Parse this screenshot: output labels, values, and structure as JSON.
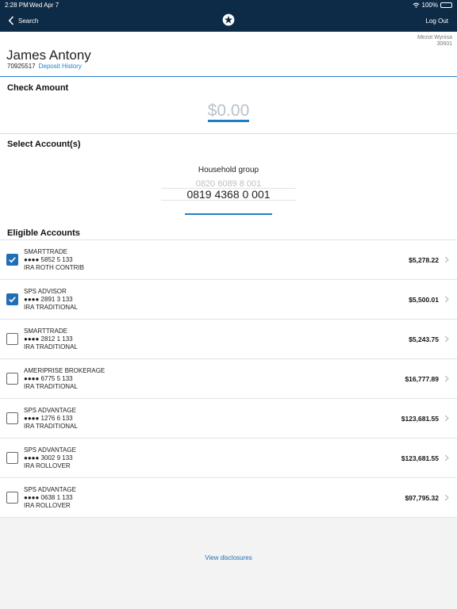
{
  "status": {
    "time": "2:28 PM",
    "date": "Wed Apr 7",
    "battery": "100%"
  },
  "nav": {
    "back_label": "Search",
    "logout_label": "Log Out"
  },
  "rep": {
    "name": "Mezot Wynisa",
    "code": "30601"
  },
  "client": {
    "name": "James Antony",
    "id": "70925517",
    "deposit_history": "Deposit History"
  },
  "check": {
    "title": "Check Amount",
    "amount": "$0.00"
  },
  "select": {
    "title": "Select Account(s)",
    "group_label": "Household group",
    "options": [
      "0820 6089 8 001",
      "0819 4368 0 001"
    ],
    "selected": "0819 4368 0 001"
  },
  "eligible": {
    "title": "Eligible Accounts",
    "accounts": [
      {
        "name": "SMARTTRADE",
        "number": "●●●● 5852 5 133",
        "type": "IRA ROTH CONTRIB",
        "balance": "$5,278.22",
        "checked": true
      },
      {
        "name": "SPS ADVISOR",
        "number": "●●●● 2891 3 133",
        "type": "IRA TRADITIONAL",
        "balance": "$5,500.01",
        "checked": true
      },
      {
        "name": "SMARTTRADE",
        "number": "●●●● 2812 1 133",
        "type": "IRA TRADITIONAL",
        "balance": "$5,243.75",
        "checked": false
      },
      {
        "name": "AMERIPRISE BROKERAGE",
        "number": "●●●● 6775 5 133",
        "type": "IRA TRADITIONAL",
        "balance": "$16,777.89",
        "checked": false
      },
      {
        "name": "SPS ADVANTAGE",
        "number": "●●●● 1276 6 133",
        "type": "IRA TRADITIONAL",
        "balance": "$123,681.55",
        "checked": false
      },
      {
        "name": "SPS ADVANTAGE",
        "number": "●●●● 3002 9 133",
        "type": "IRA ROLLOVER",
        "balance": "$123,681.55",
        "checked": false
      },
      {
        "name": "SPS ADVANTAGE",
        "number": "●●●● 0638 1 133",
        "type": "IRA ROLLOVER",
        "balance": "$97,795.32",
        "checked": false
      }
    ]
  },
  "footer": {
    "disclosures": "View disclosures"
  },
  "colors": {
    "header": "#0d2a47",
    "accent": "#1f7fc6",
    "checkbox": "#1f6fb7"
  }
}
